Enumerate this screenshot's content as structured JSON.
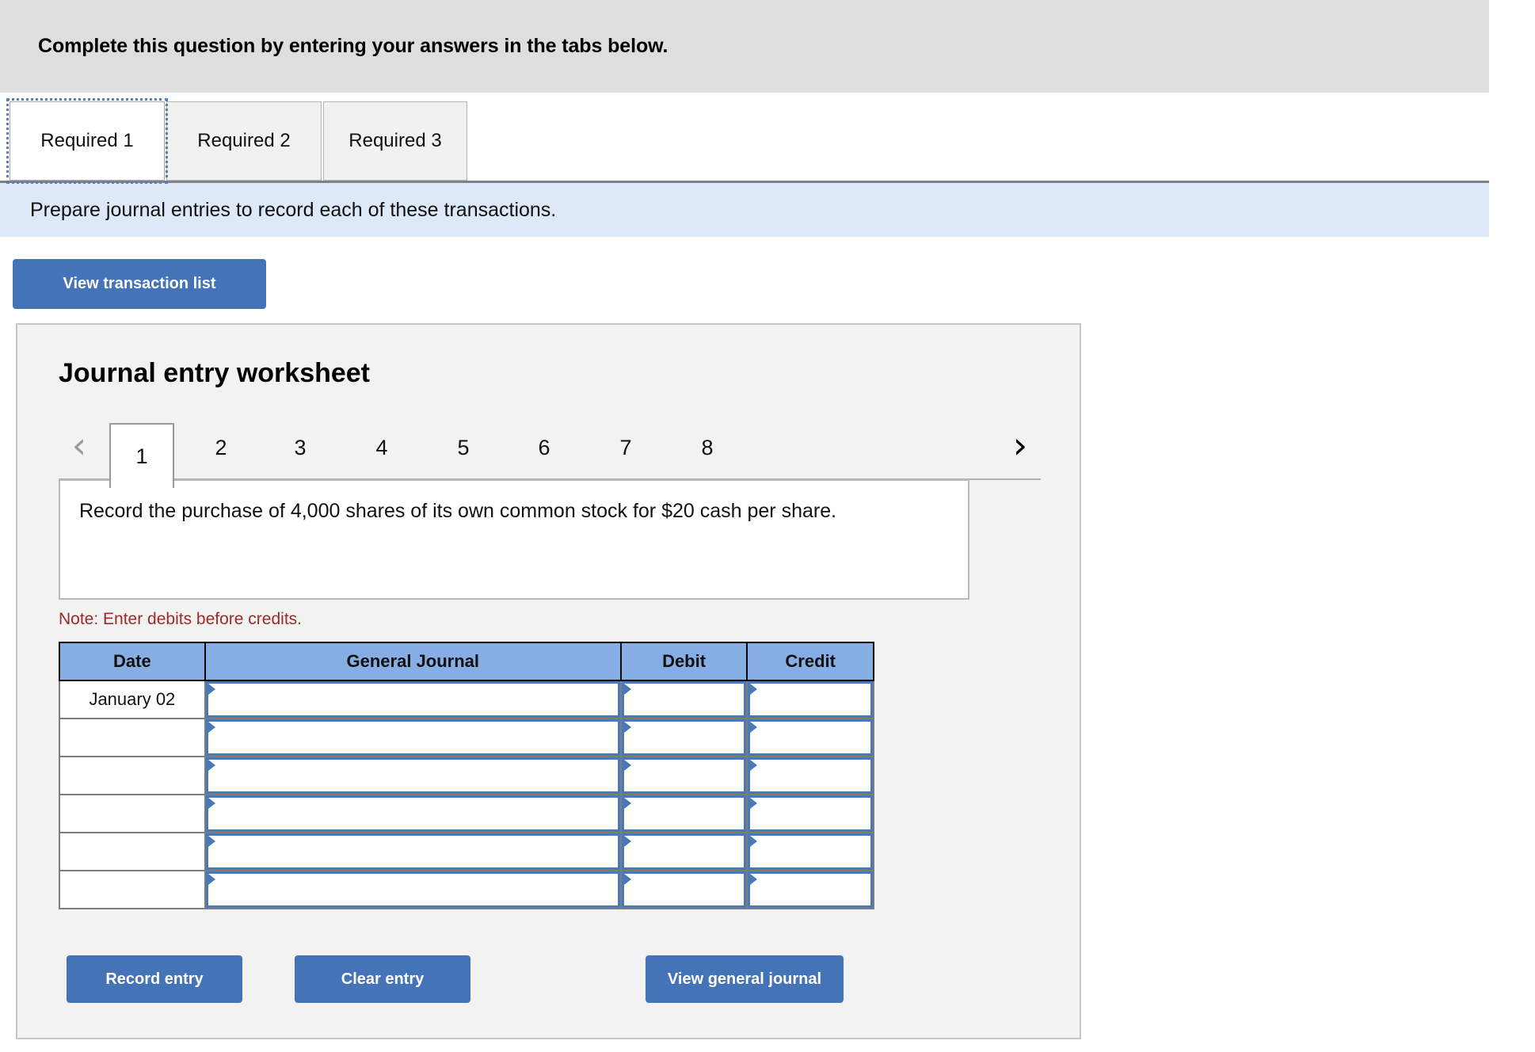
{
  "banner": {
    "text": "Complete this question by entering your answers in the tabs below."
  },
  "tabs": [
    {
      "label": "Required 1",
      "active": true
    },
    {
      "label": "Required 2",
      "active": false
    },
    {
      "label": "Required 3",
      "active": false
    }
  ],
  "instruction": {
    "text": "Prepare journal entries to record each of these transactions."
  },
  "toolbar": {
    "view_transaction_label": "View transaction list"
  },
  "worksheet": {
    "title": "Journal entry worksheet",
    "pager": {
      "prev_icon": "chevron-left-icon",
      "prev_glyph": "‹",
      "next_icon": "chevron-right-icon",
      "next_glyph": "›",
      "pages": [
        "1",
        "2",
        "3",
        "4",
        "5",
        "6",
        "7",
        "8"
      ],
      "active_page": "1"
    },
    "description": "Record the purchase of 4,000 shares of its own common stock for $20 cash per share.",
    "note": "Note: Enter debits before credits.",
    "table": {
      "headers": [
        "Date",
        "General Journal",
        "Debit",
        "Credit"
      ],
      "rows": [
        {
          "date": "January 02",
          "general_journal": "",
          "debit": "",
          "credit": ""
        },
        {
          "date": "",
          "general_journal": "",
          "debit": "",
          "credit": ""
        },
        {
          "date": "",
          "general_journal": "",
          "debit": "",
          "credit": ""
        },
        {
          "date": "",
          "general_journal": "",
          "debit": "",
          "credit": ""
        },
        {
          "date": "",
          "general_journal": "",
          "debit": "",
          "credit": ""
        },
        {
          "date": "",
          "general_journal": "",
          "debit": "",
          "credit": ""
        }
      ]
    },
    "actions": {
      "record_entry_label": "Record entry",
      "clear_entry_label": "Clear entry",
      "view_general_journal_label": "View general journal"
    }
  },
  "colors": {
    "banner_bg": "#dedede",
    "instruction_bg": "#dde9f7",
    "button_blue": "#4573b8",
    "table_header_blue": "#86aee4",
    "panel_bg": "#f2f2f2",
    "note_red": "#9b2b26",
    "field_border_blue": "#4a7ab5"
  }
}
